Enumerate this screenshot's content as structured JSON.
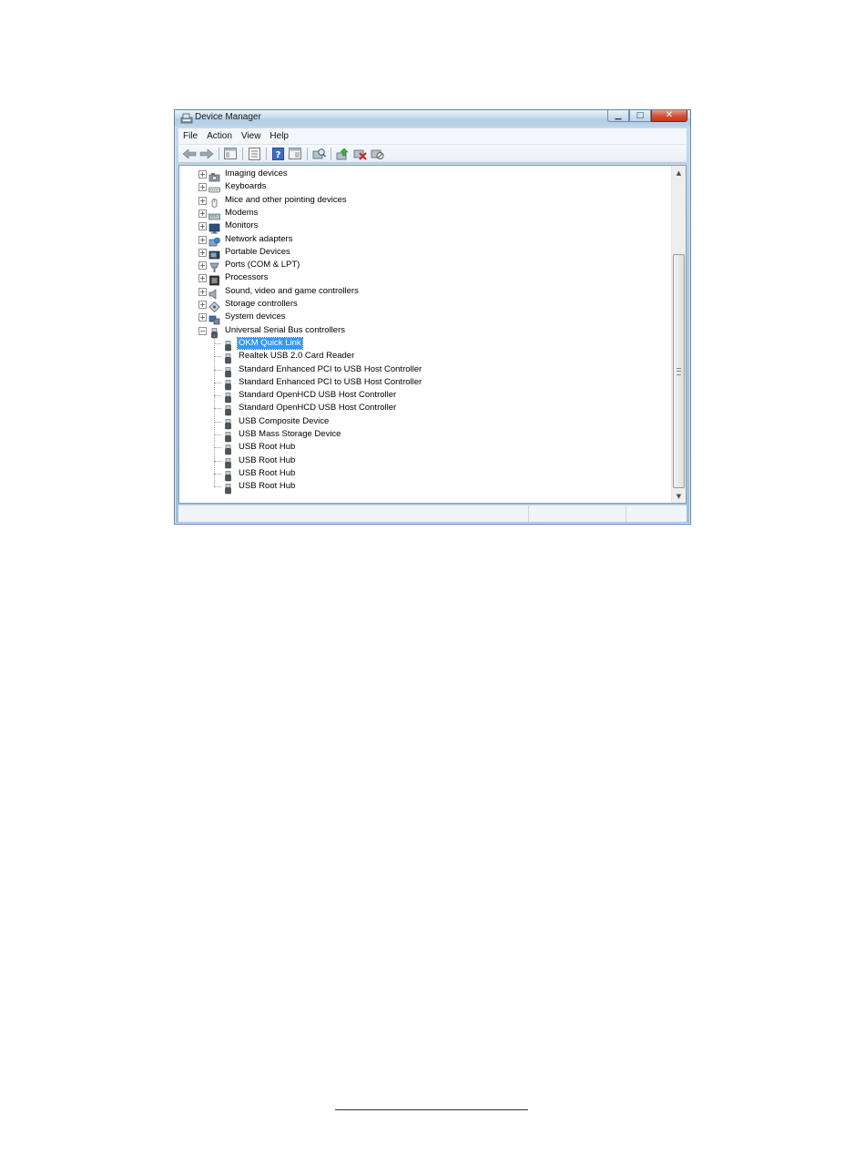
{
  "window": {
    "title": "Device Manager"
  },
  "menu": [
    "File",
    "Action",
    "View",
    "Help"
  ],
  "toolbar": {
    "buttons": [
      "back-icon",
      "forward-icon",
      "show-hide-tree-icon",
      "properties-icon",
      "help-icon",
      "view-icon",
      "scan-hardware-icon",
      "update-driver-icon",
      "uninstall-icon",
      "disable-icon"
    ]
  },
  "tree": {
    "categories": [
      {
        "label": "Imaging devices",
        "icon": "camera-icon",
        "expanded": false
      },
      {
        "label": "Keyboards",
        "icon": "keyboard-icon",
        "expanded": false
      },
      {
        "label": "Mice and other pointing devices",
        "icon": "mouse-icon",
        "expanded": false
      },
      {
        "label": "Modems",
        "icon": "modem-icon",
        "expanded": false
      },
      {
        "label": "Monitors",
        "icon": "monitor-icon",
        "expanded": false
      },
      {
        "label": "Network adapters",
        "icon": "network-adapter-icon",
        "expanded": false
      },
      {
        "label": "Portable Devices",
        "icon": "portable-device-icon",
        "expanded": false
      },
      {
        "label": "Ports (COM & LPT)",
        "icon": "port-icon",
        "expanded": false
      },
      {
        "label": "Processors",
        "icon": "processor-icon",
        "expanded": false
      },
      {
        "label": "Sound, video and game controllers",
        "icon": "speaker-icon",
        "expanded": false
      },
      {
        "label": "Storage controllers",
        "icon": "storage-icon",
        "expanded": false
      },
      {
        "label": "System devices",
        "icon": "system-icon",
        "expanded": false
      },
      {
        "label": "Universal Serial Bus controllers",
        "icon": "usb-icon",
        "expanded": true
      }
    ],
    "usb_children": [
      {
        "label": "OKM Quick Link",
        "selected": true
      },
      {
        "label": "Realtek USB 2.0 Card Reader",
        "selected": false
      },
      {
        "label": "Standard Enhanced PCI to USB Host Controller",
        "selected": false
      },
      {
        "label": "Standard Enhanced PCI to USB Host Controller",
        "selected": false
      },
      {
        "label": "Standard OpenHCD USB Host Controller",
        "selected": false
      },
      {
        "label": "Standard OpenHCD USB Host Controller",
        "selected": false
      },
      {
        "label": "USB Composite Device",
        "selected": false
      },
      {
        "label": "USB Mass Storage Device",
        "selected": false
      },
      {
        "label": "USB Root Hub",
        "selected": false
      },
      {
        "label": "USB Root Hub",
        "selected": false
      },
      {
        "label": "USB Root Hub",
        "selected": false
      },
      {
        "label": "USB Root Hub",
        "selected": false
      }
    ]
  },
  "colors": {
    "selection": "#3399ff",
    "window_frame": "#a9c8e2",
    "close_button": "#c2361c"
  }
}
